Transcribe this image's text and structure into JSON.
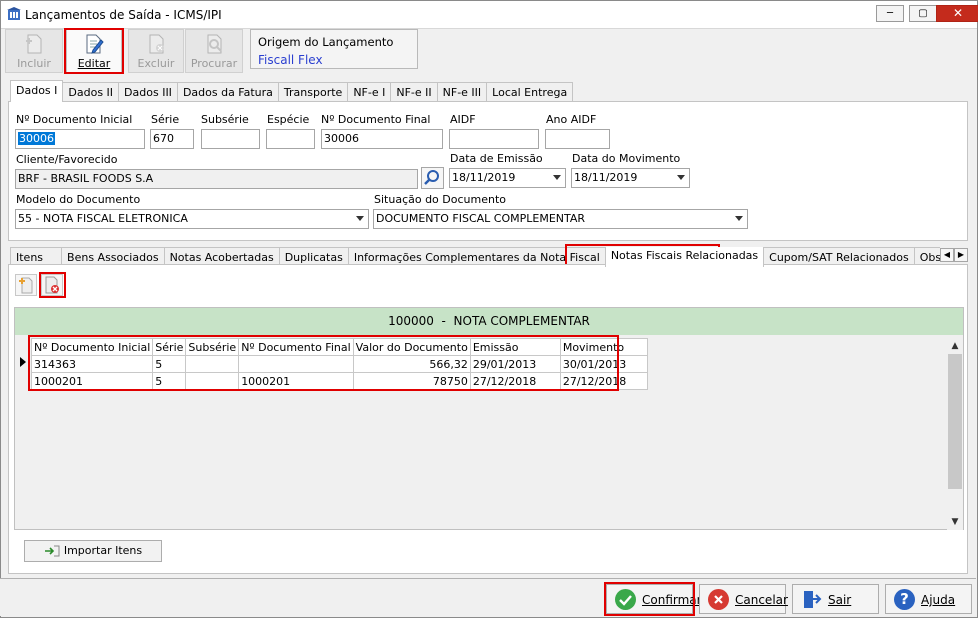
{
  "window": {
    "title": "Lançamentos de Saída - ICMS/IPI",
    "min": "─",
    "max": "▢",
    "close": "✕"
  },
  "toolbar": {
    "incluir": "Incluir",
    "editar": "Editar",
    "excluir": "Excluir",
    "procurar": "Procurar"
  },
  "origem": {
    "label": "Origem do Lançamento",
    "value": "Fiscall Flex"
  },
  "main_tabs": [
    "Dados I",
    "Dados II",
    "Dados III",
    "Dados da Fatura",
    "Transporte",
    "NF-e I",
    "NF-e II",
    "NF-e III",
    "Local Entrega"
  ],
  "form": {
    "num_doc_inicial": {
      "label": "Nº Documento Inicial",
      "value": "30006"
    },
    "serie": {
      "label": "Série",
      "value": "670"
    },
    "subserie": {
      "label": "Subsérie",
      "value": ""
    },
    "especie": {
      "label": "Espécie",
      "value": ""
    },
    "num_doc_final": {
      "label": "Nº Documento Final",
      "value": "30006"
    },
    "aidf": {
      "label": "AIDF",
      "value": ""
    },
    "ano_aidf": {
      "label": "Ano AIDF",
      "value": ""
    },
    "cliente": {
      "label": "Cliente/Favorecido",
      "value": "BRF - BRASIL FOODS S.A"
    },
    "data_emissao": {
      "label": "Data de Emissão",
      "value": "18/11/2019"
    },
    "data_movimento": {
      "label": "Data do Movimento",
      "value": "18/11/2019"
    },
    "modelo": {
      "label": "Modelo do Documento",
      "value": "55 - NOTA FISCAL ELETRONICA"
    },
    "situacao": {
      "label": "Situação do Documento",
      "value": "DOCUMENTO FISCAL COMPLEMENTAR"
    }
  },
  "sub_tabs": [
    "Itens",
    "Bens Associados",
    "Notas Acobertadas",
    "Duplicatas",
    "Informações Complementares da Nota Fiscal",
    "Notas Fiscais Relacionadas",
    "Cupom/SAT Relacionados",
    "Observação d"
  ],
  "grid": {
    "group_code": "100000",
    "group_sep": "-",
    "group_name": "NOTA COMPLEMENTAR",
    "columns": [
      "Nº Documento Inicial",
      "Série",
      "Subsérie",
      "Nº Documento Final",
      "Valor do Documento",
      "Emissão",
      "Movimento"
    ],
    "rows": [
      [
        "314363",
        "5",
        "",
        "",
        "566,32",
        "29/01/2013",
        "30/01/2013"
      ],
      [
        "1000201",
        "5",
        "",
        "1000201",
        "78750",
        "27/12/2018",
        "27/12/2018"
      ]
    ]
  },
  "import_button": "Importar Itens",
  "footer": {
    "confirmar": "Confirmar",
    "cancelar": "Cancelar",
    "sair": "Sair",
    "ajuda": "Ajuda"
  },
  "colors": {
    "highlight": "#e00000",
    "group_header": "#c7e3c7",
    "link": "#2a3fd0"
  }
}
